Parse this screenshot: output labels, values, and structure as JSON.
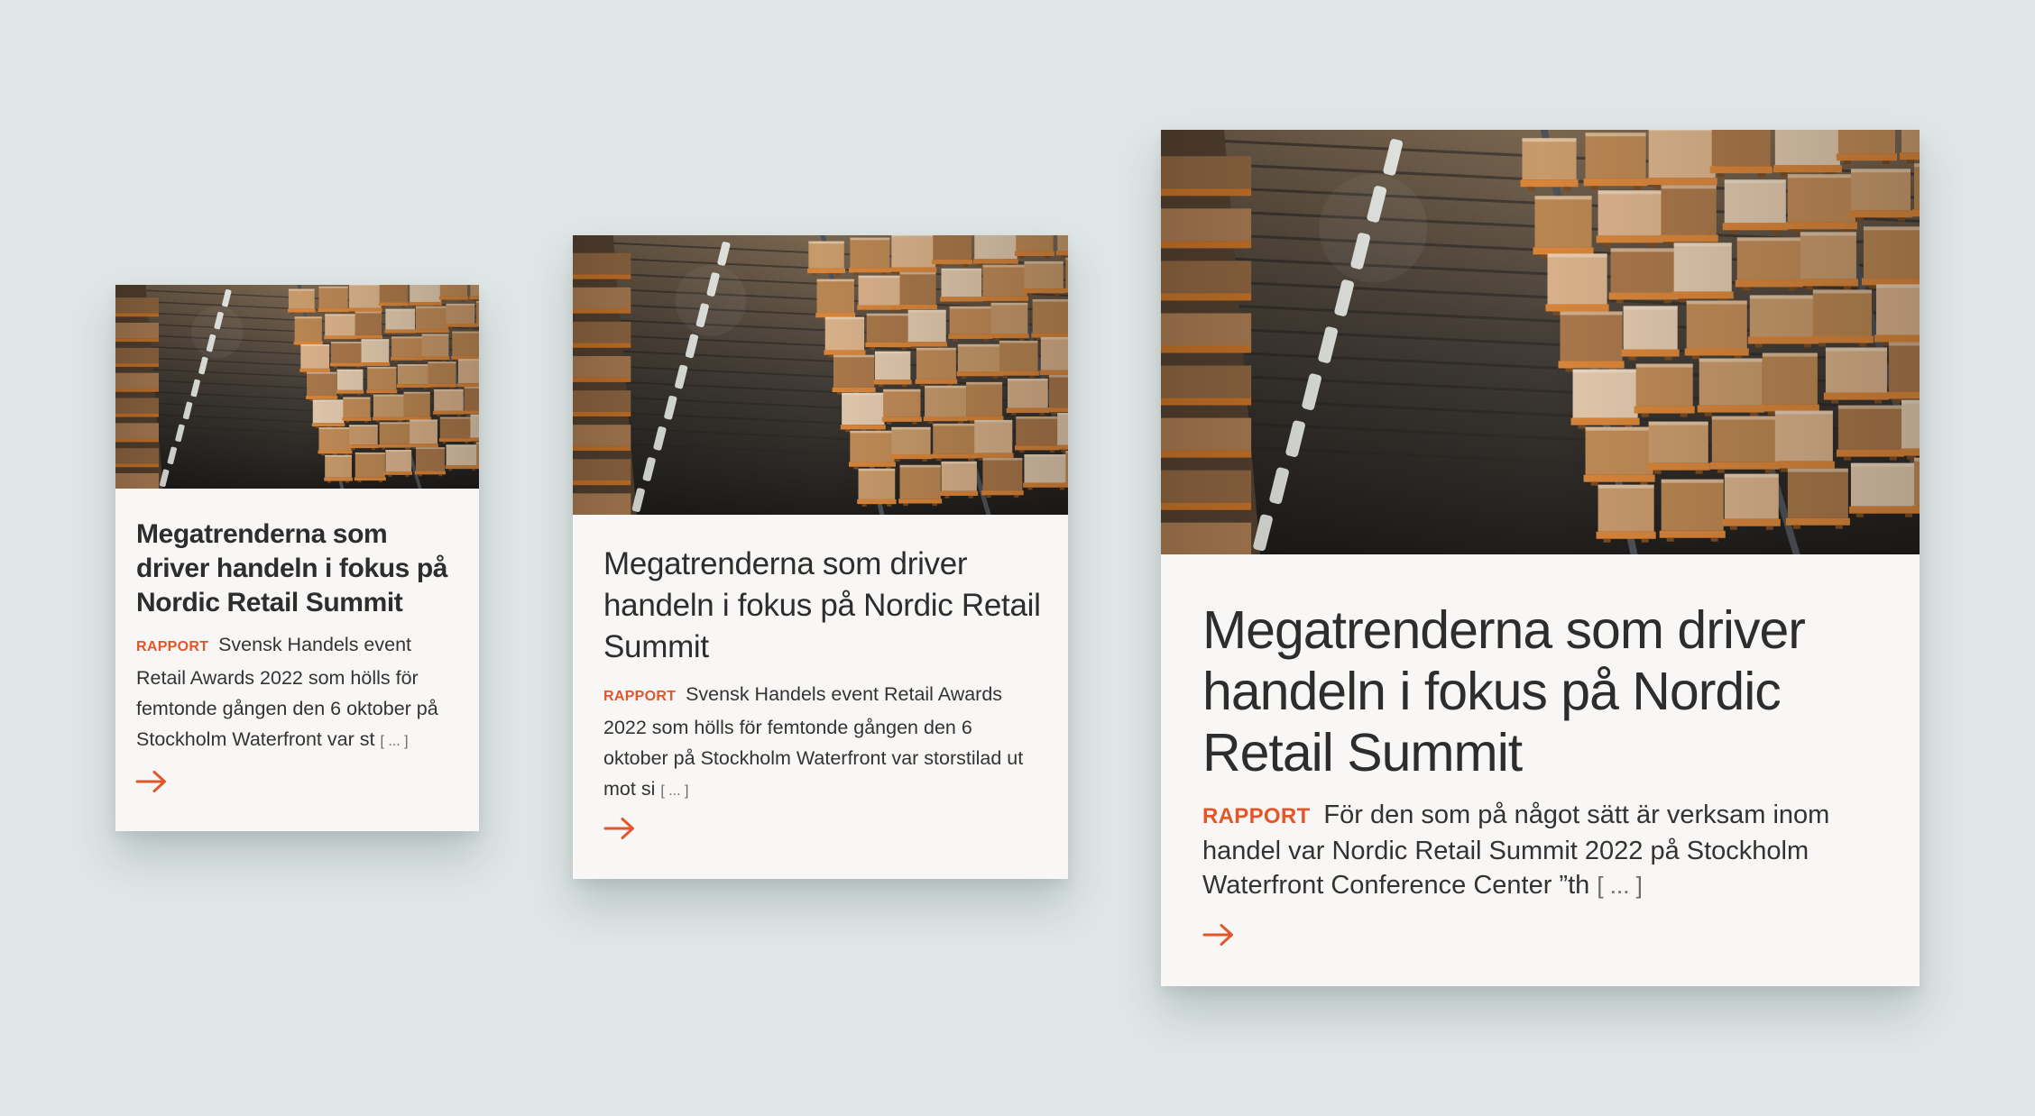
{
  "cards": [
    {
      "size": "small",
      "image_alt": "warehouse-shelves-photo",
      "title": "Megatrenderna som driver handeln i fokus på Nordic Retail Summit",
      "tag": "RAPPORT",
      "excerpt": "Svensk Handels event Retail Awards 2022 som hölls för femtonde gången den 6 oktober på Stockholm Waterfront var st",
      "ellipsis": "[ ... ]",
      "arrow_icon": "arrow-right-icon"
    },
    {
      "size": "medium",
      "image_alt": "warehouse-shelves-photo",
      "title": "Megatrenderna som driver handeln i fokus på Nordic Retail Summit",
      "tag": "RAPPORT",
      "excerpt": "Svensk Handels event Retail Awards 2022 som hölls för femtonde gången den 6 oktober på Stockholm Waterfront var storstilad ut mot si",
      "ellipsis": "[ ... ]",
      "arrow_icon": "arrow-right-icon"
    },
    {
      "size": "large",
      "image_alt": "warehouse-shelves-photo",
      "title": "Megatrenderna som driver handeln i fokus på Nordic Retail Summit",
      "tag": "RAPPORT",
      "excerpt": "För den som på något sätt är verksam inom handel var Nordic Retail Summit 2022 på Stockholm Waterfront Conference Center ”th",
      "ellipsis": "[ ... ]",
      "arrow_icon": "arrow-right-icon"
    }
  ],
  "colors": {
    "background": "#dfe6e6",
    "card": "#f8f7f5",
    "title": "#2d2d2d",
    "tag": "#e2562a",
    "arrow": "#e2562a"
  }
}
